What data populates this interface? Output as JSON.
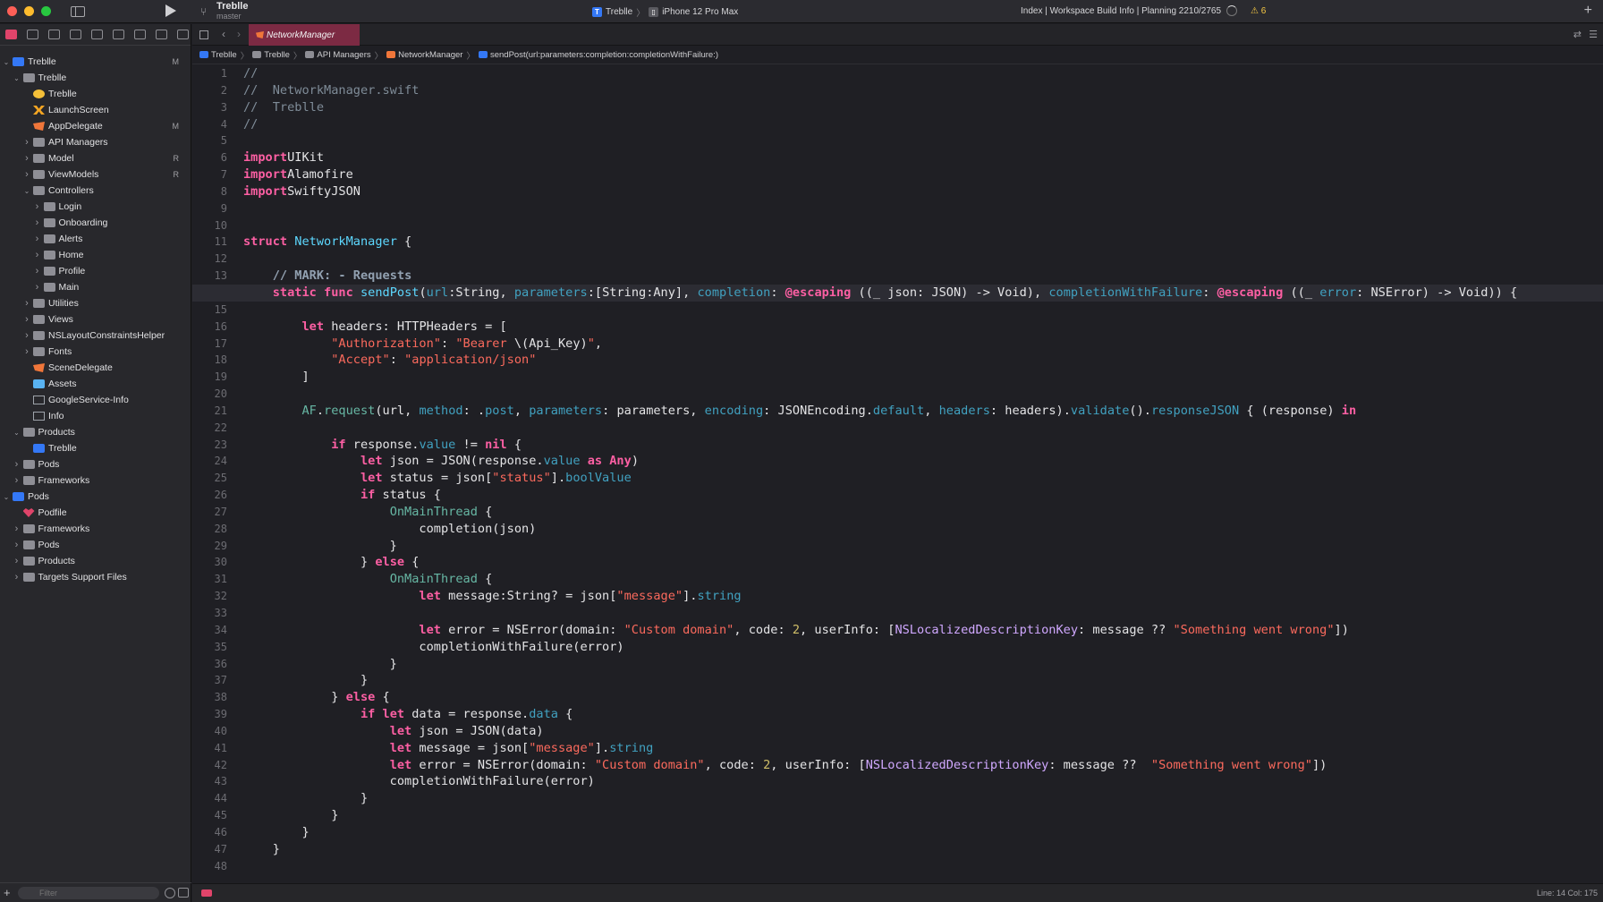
{
  "toolbar": {
    "project_name": "Treblle",
    "branch": "master",
    "scheme_app": "Treblle",
    "scheme_device": "iPhone 12 Pro Max",
    "status": "Index | Workspace Build Info | Planning 2210/2765",
    "warning_count": "⚠ 6"
  },
  "navigator": {
    "items": [
      {
        "label": "Treblle",
        "badge": "M",
        "depth": 0,
        "chev": "down",
        "icon": "proj"
      },
      {
        "label": "Treblle",
        "badge": "",
        "depth": 1,
        "chev": "down",
        "icon": "folder"
      },
      {
        "label": "Treblle",
        "badge": "",
        "depth": 2,
        "chev": "",
        "icon": "storyboard"
      },
      {
        "label": "LaunchScreen",
        "badge": "",
        "depth": 2,
        "chev": "",
        "icon": "xib"
      },
      {
        "label": "AppDelegate",
        "badge": "M",
        "depth": 2,
        "chev": "",
        "icon": "swift"
      },
      {
        "label": "API Managers",
        "badge": "",
        "depth": 2,
        "chev": "right",
        "icon": "folder"
      },
      {
        "label": "Model",
        "badge": "R",
        "depth": 2,
        "chev": "right",
        "icon": "folder"
      },
      {
        "label": "ViewModels",
        "badge": "R",
        "depth": 2,
        "chev": "right",
        "icon": "folder"
      },
      {
        "label": "Controllers",
        "badge": "",
        "depth": 2,
        "chev": "down",
        "icon": "folder"
      },
      {
        "label": "Login",
        "badge": "",
        "depth": 3,
        "chev": "right",
        "icon": "folder"
      },
      {
        "label": "Onboarding",
        "badge": "",
        "depth": 3,
        "chev": "right",
        "icon": "folder"
      },
      {
        "label": "Alerts",
        "badge": "",
        "depth": 3,
        "chev": "right",
        "icon": "folder"
      },
      {
        "label": "Home",
        "badge": "",
        "depth": 3,
        "chev": "right",
        "icon": "folder"
      },
      {
        "label": "Profile",
        "badge": "",
        "depth": 3,
        "chev": "right",
        "icon": "folder"
      },
      {
        "label": "Main",
        "badge": "",
        "depth": 3,
        "chev": "right",
        "icon": "folder"
      },
      {
        "label": "Utilities",
        "badge": "",
        "depth": 2,
        "chev": "right",
        "icon": "folder"
      },
      {
        "label": "Views",
        "badge": "",
        "depth": 2,
        "chev": "right",
        "icon": "folder"
      },
      {
        "label": "NSLayoutConstraintsHelper",
        "badge": "",
        "depth": 2,
        "chev": "right",
        "icon": "folder"
      },
      {
        "label": "Fonts",
        "badge": "",
        "depth": 2,
        "chev": "right",
        "icon": "folder"
      },
      {
        "label": "SceneDelegate",
        "badge": "",
        "depth": 2,
        "chev": "",
        "icon": "swift"
      },
      {
        "label": "Assets",
        "badge": "",
        "depth": 2,
        "chev": "",
        "icon": "assets"
      },
      {
        "label": "GoogleService-Info",
        "badge": "",
        "depth": 2,
        "chev": "",
        "icon": "plist"
      },
      {
        "label": "Info",
        "badge": "",
        "depth": 2,
        "chev": "",
        "icon": "plist"
      },
      {
        "label": "Products",
        "badge": "",
        "depth": 1,
        "chev": "down",
        "icon": "folder"
      },
      {
        "label": "Treblle",
        "badge": "",
        "depth": 2,
        "chev": "",
        "icon": "app"
      },
      {
        "label": "Pods",
        "badge": "",
        "depth": 1,
        "chev": "right",
        "icon": "folder"
      },
      {
        "label": "Frameworks",
        "badge": "",
        "depth": 1,
        "chev": "right",
        "icon": "folder"
      },
      {
        "label": "Pods",
        "badge": "",
        "depth": 0,
        "chev": "down",
        "icon": "proj"
      },
      {
        "label": "Podfile",
        "badge": "",
        "depth": 1,
        "chev": "",
        "icon": "podfile"
      },
      {
        "label": "Frameworks",
        "badge": "",
        "depth": 1,
        "chev": "right",
        "icon": "folder"
      },
      {
        "label": "Pods",
        "badge": "",
        "depth": 1,
        "chev": "right",
        "icon": "folder"
      },
      {
        "label": "Products",
        "badge": "",
        "depth": 1,
        "chev": "right",
        "icon": "folder"
      },
      {
        "label": "Targets Support Files",
        "badge": "",
        "depth": 1,
        "chev": "right",
        "icon": "folder"
      }
    ],
    "filter_placeholder": "Filter"
  },
  "editor": {
    "active_tab": "NetworkManager",
    "breadcrumb": [
      "Treblle",
      "Treblle",
      "API Managers",
      "NetworkManager",
      "sendPost(url:parameters:completion:completionWithFailure:)"
    ],
    "current_line": 14,
    "status_line_col": "Line: 14  Col: 175",
    "code_lines": [
      [
        [
          "cm",
          "//"
        ]
      ],
      [
        [
          "cm",
          "//  NetworkManager.swift"
        ]
      ],
      [
        [
          "cm",
          "//  Treblle"
        ]
      ],
      [
        [
          "cm",
          "//"
        ]
      ],
      [],
      [
        [
          "kw",
          "import"
        ],
        [
          "",
          "UIKit"
        ]
      ],
      [
        [
          "kw",
          "import"
        ],
        [
          "",
          "Alamofire"
        ]
      ],
      [
        [
          "kw",
          "import"
        ],
        [
          "",
          "SwiftyJSON"
        ]
      ],
      [],
      [],
      [
        [
          "kw",
          "struct"
        ],
        [
          "",
          " "
        ],
        [
          "ty",
          "NetworkManager"
        ],
        [
          "",
          " {"
        ]
      ],
      [],
      [
        [
          "",
          "    "
        ],
        [
          "mk",
          "// MARK: - Requests"
        ]
      ],
      [
        [
          "",
          "    "
        ],
        [
          "kw",
          "static func"
        ],
        [
          "",
          " "
        ],
        [
          "ty",
          "sendPost"
        ],
        [
          "",
          "("
        ],
        [
          "pr",
          "url"
        ],
        [
          "",
          ":String, "
        ],
        [
          "pr",
          "parameters"
        ],
        [
          "",
          ":[String:Any], "
        ],
        [
          "pr",
          "completion"
        ],
        [
          "",
          ": "
        ],
        [
          "kw",
          "@escaping"
        ],
        [
          "",
          " ((_ json: JSON) -> Void), "
        ],
        [
          "pr",
          "completionWithFailure"
        ],
        [
          "",
          ": "
        ],
        [
          "kw",
          "@escaping"
        ],
        [
          "",
          " ((_ "
        ],
        [
          "pr",
          "error"
        ],
        [
          "",
          ": NSError) -> Void)) {"
        ]
      ],
      [],
      [
        [
          "",
          "        "
        ],
        [
          "kw",
          "let"
        ],
        [
          "",
          " headers: HTTPHeaders = ["
        ]
      ],
      [
        [
          "",
          "            "
        ],
        [
          "str",
          "\"Authorization\""
        ],
        [
          "",
          ": "
        ],
        [
          "str",
          "\"Bearer "
        ],
        [
          "",
          "\\(Api_Key)"
        ],
        [
          "str",
          "\""
        ],
        [
          "",
          ","
        ]
      ],
      [
        [
          "",
          "            "
        ],
        [
          "str",
          "\"Accept\""
        ],
        [
          "",
          ": "
        ],
        [
          "str",
          "\"application/json\""
        ]
      ],
      [
        [
          "",
          "        ]"
        ]
      ],
      [],
      [
        [
          "",
          "        "
        ],
        [
          "fn",
          "AF"
        ],
        [
          "",
          "."
        ],
        [
          "fn",
          "request"
        ],
        [
          "",
          "(url, "
        ],
        [
          "pr",
          "method"
        ],
        [
          "",
          ": ."
        ],
        [
          "pr",
          "post"
        ],
        [
          "",
          ", "
        ],
        [
          "pr",
          "parameters"
        ],
        [
          "",
          ": parameters, "
        ],
        [
          "pr",
          "encoding"
        ],
        [
          "",
          ": JSONEncoding."
        ],
        [
          "pr",
          "default"
        ],
        [
          "",
          ", "
        ],
        [
          "pr",
          "headers"
        ],
        [
          "",
          ": headers)."
        ],
        [
          "pr",
          "validate"
        ],
        [
          "",
          "()."
        ],
        [
          "pr",
          "responseJSON"
        ],
        [
          "",
          " { (response) "
        ],
        [
          "kw",
          "in"
        ]
      ],
      [],
      [
        [
          "",
          "            "
        ],
        [
          "kw",
          "if"
        ],
        [
          "",
          " response."
        ],
        [
          "pr",
          "value"
        ],
        [
          "",
          " != "
        ],
        [
          "kw",
          "nil"
        ],
        [
          "",
          " {"
        ]
      ],
      [
        [
          "",
          "                "
        ],
        [
          "kw",
          "let"
        ],
        [
          "",
          " json = JSON(response."
        ],
        [
          "pr",
          "value"
        ],
        [
          "",
          " "
        ],
        [
          "kw",
          "as"
        ],
        [
          "",
          " "
        ],
        [
          "kw",
          "Any"
        ],
        [
          "",
          ")"
        ]
      ],
      [
        [
          "",
          "                "
        ],
        [
          "kw",
          "let"
        ],
        [
          "",
          " status = json["
        ],
        [
          "str",
          "\"status\""
        ],
        [
          "",
          "]."
        ],
        [
          "pr",
          "boolValue"
        ]
      ],
      [
        [
          "",
          "                "
        ],
        [
          "kw",
          "if"
        ],
        [
          "",
          " status {"
        ]
      ],
      [
        [
          "",
          "                    "
        ],
        [
          "fn",
          "OnMainThread"
        ],
        [
          "",
          " {"
        ]
      ],
      [
        [
          "",
          "                        completion(json)"
        ]
      ],
      [
        [
          "",
          "                    }"
        ]
      ],
      [
        [
          "",
          "                } "
        ],
        [
          "kw",
          "else"
        ],
        [
          "",
          " {"
        ]
      ],
      [
        [
          "",
          "                    "
        ],
        [
          "fn",
          "OnMainThread"
        ],
        [
          "",
          " {"
        ]
      ],
      [
        [
          "",
          "                        "
        ],
        [
          "kw",
          "let"
        ],
        [
          "",
          " message:String? = json["
        ],
        [
          "str",
          "\"message\""
        ],
        [
          "",
          "]."
        ],
        [
          "pr",
          "string"
        ]
      ],
      [],
      [
        [
          "",
          "                        "
        ],
        [
          "kw",
          "let"
        ],
        [
          "",
          " error = NSError(domain: "
        ],
        [
          "str",
          "\"Custom domain\""
        ],
        [
          "",
          ", code: "
        ],
        [
          "num",
          "2"
        ],
        [
          "",
          ", userInfo: ["
        ],
        [
          "ty2",
          "NSLocalizedDescriptionKey"
        ],
        [
          "",
          ": message ?? "
        ],
        [
          "str",
          "\"Something went wrong\""
        ],
        [
          "",
          "])"
        ]
      ],
      [
        [
          "",
          "                        completionWithFailure(error)"
        ]
      ],
      [
        [
          "",
          "                    }"
        ]
      ],
      [
        [
          "",
          "                }"
        ]
      ],
      [
        [
          "",
          "            } "
        ],
        [
          "kw",
          "else"
        ],
        [
          "",
          " {"
        ]
      ],
      [
        [
          "",
          "                "
        ],
        [
          "kw",
          "if let"
        ],
        [
          "",
          " data = response."
        ],
        [
          "pr",
          "data"
        ],
        [
          "",
          " {"
        ]
      ],
      [
        [
          "",
          "                    "
        ],
        [
          "kw",
          "let"
        ],
        [
          "",
          " json = JSON(data)"
        ]
      ],
      [
        [
          "",
          "                    "
        ],
        [
          "kw",
          "let"
        ],
        [
          "",
          " message = json["
        ],
        [
          "str",
          "\"message\""
        ],
        [
          "",
          "]."
        ],
        [
          "pr",
          "string"
        ]
      ],
      [
        [
          "",
          "                    "
        ],
        [
          "kw",
          "let"
        ],
        [
          "",
          " error = NSError(domain: "
        ],
        [
          "str",
          "\"Custom domain\""
        ],
        [
          "",
          ", code: "
        ],
        [
          "num",
          "2"
        ],
        [
          "",
          ", userInfo: ["
        ],
        [
          "ty2",
          "NSLocalizedDescriptionKey"
        ],
        [
          "",
          ": message ??  "
        ],
        [
          "str",
          "\"Something went wrong\""
        ],
        [
          "",
          "])"
        ]
      ],
      [
        [
          "",
          "                    completionWithFailure(error)"
        ]
      ],
      [
        [
          "",
          "                }"
        ]
      ],
      [
        [
          "",
          "            }"
        ]
      ],
      [
        [
          "",
          "        }"
        ]
      ],
      [
        [
          "",
          "    }"
        ]
      ],
      []
    ]
  },
  "colors": {
    "accent_tab": "#7c2a43",
    "keyword": "#fc5fa3",
    "string": "#fc6a5d",
    "type": "#5dd8ff",
    "comment": "#7f8c98"
  }
}
